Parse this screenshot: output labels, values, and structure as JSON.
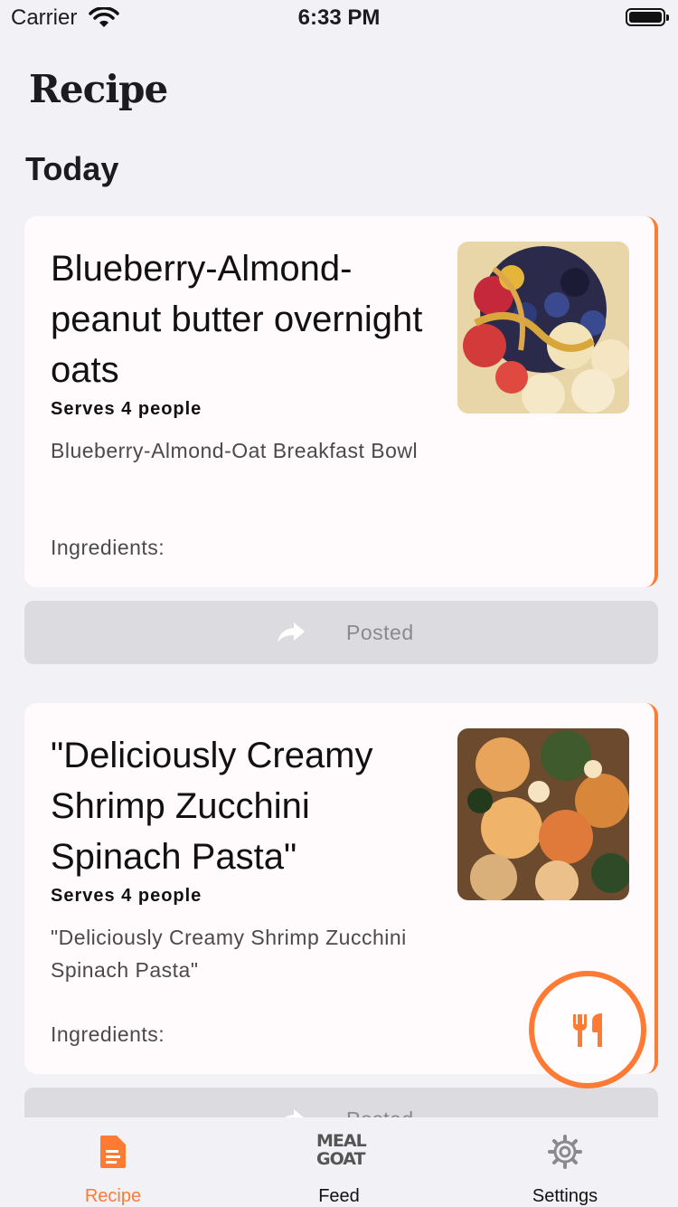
{
  "status_bar": {
    "carrier": "Carrier",
    "time": "6:33 PM"
  },
  "app": {
    "title": "Recipe"
  },
  "section": {
    "title": "Today"
  },
  "colors": {
    "accent": "#ff7a33",
    "background": "#f2f1f6",
    "card": "#fffbfd"
  },
  "recipes": [
    {
      "title": "Blueberry-Almond-peanut butter overnight oats",
      "serves": "Serves 4 people",
      "description": "Blueberry-Almond-Oat Breakfast Bowl",
      "ingredients_label": "Ingredients:",
      "posted_label": "Posted"
    },
    {
      "title": "\"Deliciously Creamy Shrimp Zucchini Spinach Pasta\"",
      "serves": "Serves 4 people",
      "description": "\"Deliciously Creamy Shrimp Zucchini Spinach Pasta\"",
      "ingredients_label": "Ingredients:",
      "posted_label": "Posted"
    }
  ],
  "fab": {
    "icon": "fork-knife-icon"
  },
  "tabs": [
    {
      "label": "Recipe",
      "icon": "document-icon",
      "active": true
    },
    {
      "label": "Feed",
      "icon": "meal-goat-logo",
      "logo_text": [
        "MEAL",
        "GOAT"
      ],
      "active": false
    },
    {
      "label": "Settings",
      "icon": "gear-icon",
      "active": false
    }
  ]
}
